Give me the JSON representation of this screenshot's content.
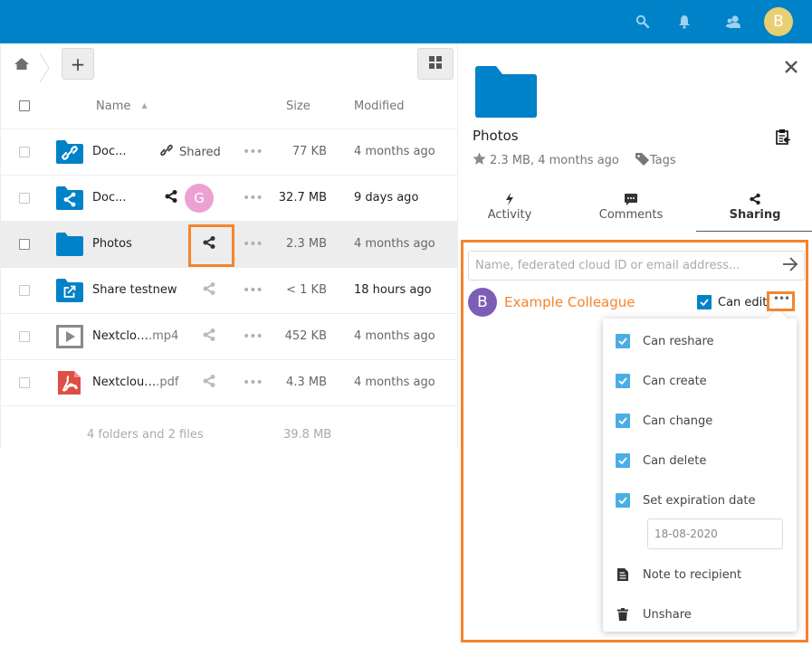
{
  "header": {
    "icons": [
      "search-icon",
      "notifications-icon",
      "contacts-icon"
    ],
    "user_avatar_letter": "B",
    "brand_color": "#0082c9"
  },
  "toolbar": {
    "new_button_label": "+",
    "home_icon": "home-icon",
    "view_toggle_icon": "grid-view-icon"
  },
  "table": {
    "columns": {
      "name": "Name",
      "size": "Size",
      "modified": "Modified"
    },
    "sort_indicator": "▲",
    "rows": [
      {
        "name": "Doc...",
        "ext": "",
        "icon": "folder-link-icon",
        "share_label": "Shared",
        "share_type": "link",
        "size": "77 KB",
        "modified": "4 months ago",
        "selected": false
      },
      {
        "name": "Doc...",
        "ext": "",
        "icon": "folder-shared-icon",
        "share_label": "",
        "share_type": "user",
        "sharer_avatar": "G",
        "size": "32.7 MB",
        "modified": "9 days ago",
        "selected": false
      },
      {
        "name": "Photos",
        "ext": "",
        "icon": "folder-icon",
        "share_label": "",
        "share_type": "share-highlighted",
        "size": "2.3 MB",
        "modified": "4 months ago",
        "selected": true
      },
      {
        "name": "Share testnew",
        "ext": "",
        "icon": "folder-external-icon",
        "share_label": "",
        "share_type": "share",
        "size": "< 1 KB",
        "modified": "18 hours ago",
        "selected": false
      },
      {
        "name": "Nextclo…",
        "ext": ".mp4",
        "icon": "video-icon",
        "share_label": "",
        "share_type": "share",
        "size": "452 KB",
        "modified": "4 months ago",
        "selected": false
      },
      {
        "name": "Nextclou…",
        "ext": ".pdf",
        "icon": "pdf-icon",
        "share_label": "",
        "share_type": "share",
        "size": "4.3 MB",
        "modified": "4 months ago",
        "selected": false
      }
    ],
    "summary": {
      "label": "4 folders and 2 files",
      "total_size": "39.8 MB"
    }
  },
  "details": {
    "title": "Photos",
    "meta": "2.3 MB, 4 months ago",
    "tags_label": "Tags",
    "tabs": [
      {
        "label": "Activity",
        "icon": "activity-icon",
        "active": false
      },
      {
        "label": "Comments",
        "icon": "comments-icon",
        "active": false
      },
      {
        "label": "Sharing",
        "icon": "share-icon",
        "active": true
      }
    ],
    "sharing": {
      "input_placeholder": "Name, federated cloud ID or email address...",
      "sharee": {
        "avatar_letter": "B",
        "name": "Example Colleague",
        "can_edit_label": "Can edit",
        "can_edit": true
      },
      "menu": {
        "items": [
          {
            "label": "Can reshare",
            "checked": true
          },
          {
            "label": "Can create",
            "checked": true
          },
          {
            "label": "Can change",
            "checked": true
          },
          {
            "label": "Can delete",
            "checked": true
          },
          {
            "label": "Set expiration date",
            "checked": true
          }
        ],
        "expiration_date": "18-08-2020",
        "note_label": "Note to recipient",
        "unshare_label": "Unshare"
      }
    }
  },
  "highlight_color": "#f5842c"
}
